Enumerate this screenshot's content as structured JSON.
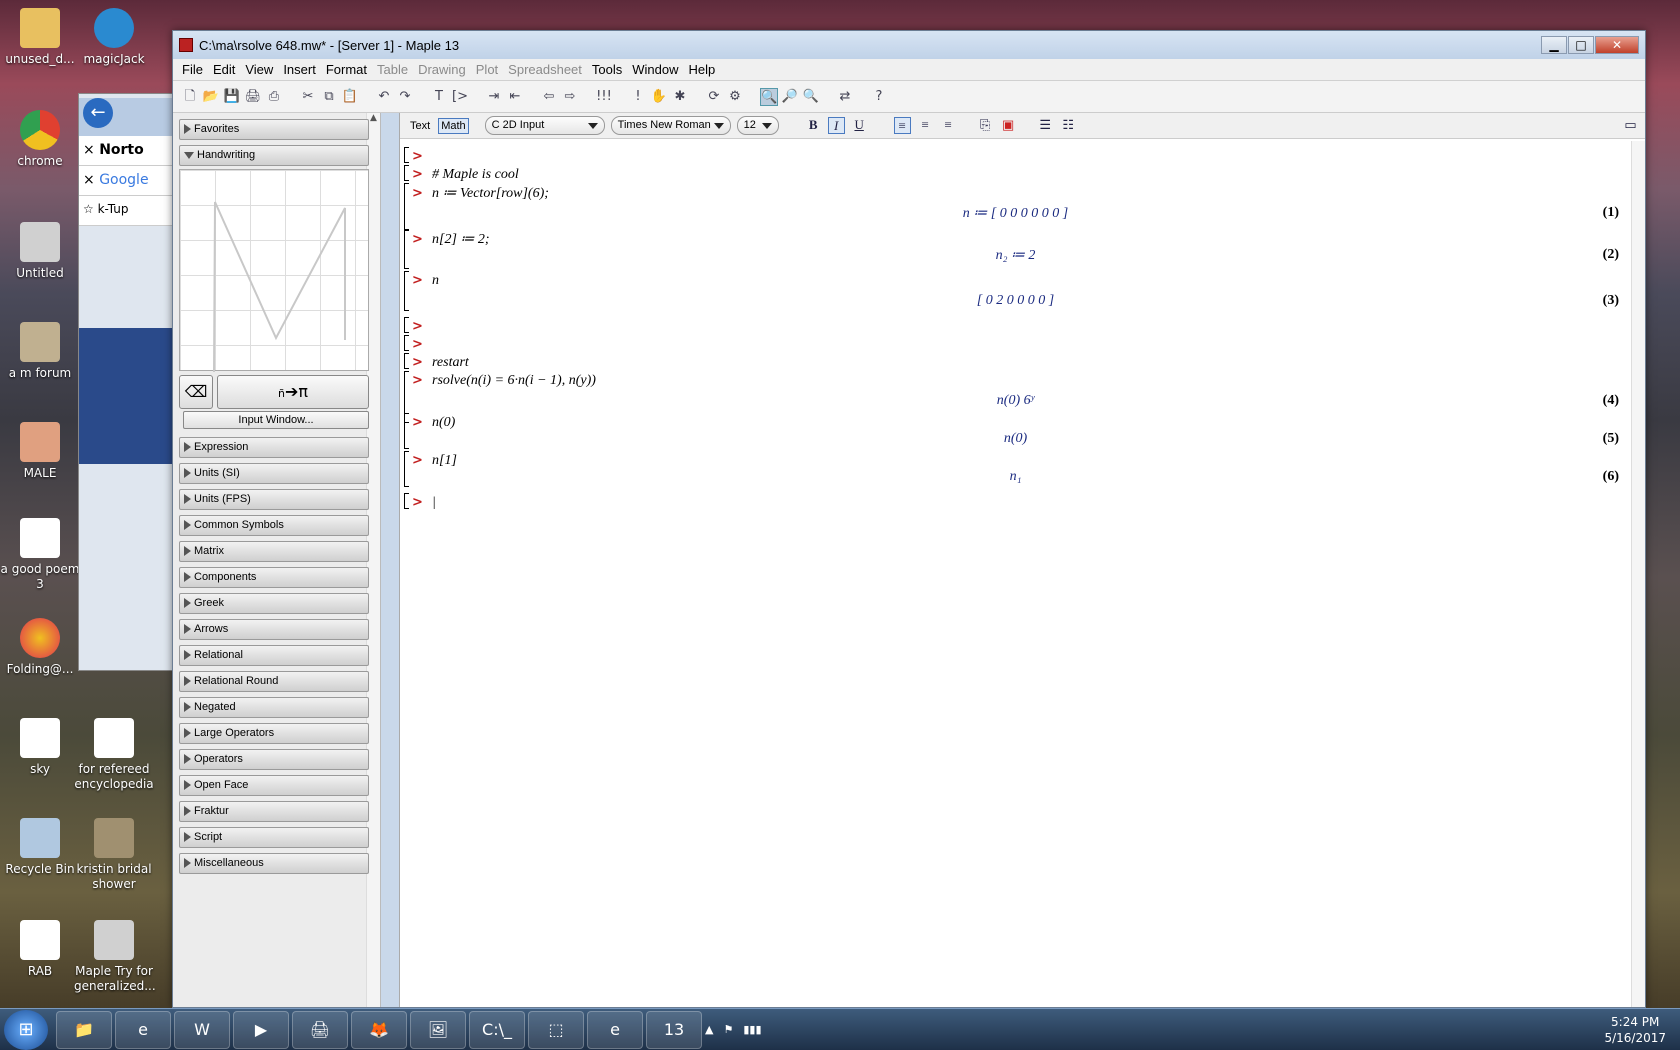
{
  "desktop": {
    "icons": [
      {
        "label": "unused_d...",
        "color": "#e8c060"
      },
      {
        "label": "magicJack",
        "color": "#2a8ad0"
      },
      {
        "label": "chrome",
        "color": "#e04030"
      },
      {
        "label": "Untitled",
        "color": "#d0d0d0"
      },
      {
        "label": "a m forum",
        "color": "#c0b090"
      },
      {
        "label": "MALE",
        "color": "#e0a080"
      },
      {
        "label": "a good poem 3",
        "color": "#ffffff"
      },
      {
        "label": "Folding@...",
        "color": "#e03050"
      },
      {
        "label": "sky",
        "color": "#ffffff"
      },
      {
        "label": "for refereed encyclopedia",
        "color": "#ffffff"
      },
      {
        "label": "Recycle Bin",
        "color": "#b0c8e0"
      },
      {
        "label": "kristin bridal shower",
        "color": "#a09070"
      },
      {
        "label": "RAB",
        "color": "#ffffff"
      },
      {
        "label": "Maple Try for generalized...",
        "color": "#d0d0d0"
      }
    ]
  },
  "bg_browser": {
    "tabs": [
      "Norto",
      "Google",
      "k-Tup"
    ]
  },
  "window": {
    "title": "C:\\ma\\rsolve 648.mw* - [Server 1] - Maple 13",
    "controls": {
      "minimize": "▁",
      "maximize": "□",
      "close": "✕"
    }
  },
  "menu": [
    {
      "label": "File",
      "enabled": true
    },
    {
      "label": "Edit",
      "enabled": true
    },
    {
      "label": "View",
      "enabled": true
    },
    {
      "label": "Insert",
      "enabled": true
    },
    {
      "label": "Format",
      "enabled": true
    },
    {
      "label": "Table",
      "enabled": false
    },
    {
      "label": "Drawing",
      "enabled": false
    },
    {
      "label": "Plot",
      "enabled": false
    },
    {
      "label": "Spreadsheet",
      "enabled": false
    },
    {
      "label": "Tools",
      "enabled": true
    },
    {
      "label": "Window",
      "enabled": true
    },
    {
      "label": "Help",
      "enabled": true
    }
  ],
  "toolbar": {
    "icons": [
      "new-icon",
      "open-icon",
      "save-icon",
      "print-icon",
      "print-preview-icon",
      "cut-icon",
      "copy-icon",
      "paste-icon",
      "undo-icon",
      "redo-icon",
      "text-icon",
      "execution-group-icon",
      "indent-icon",
      "outdent-icon",
      "back-icon",
      "forward-icon",
      "execute-all-icon",
      "execute-icon",
      "interrupt-icon",
      "debug-icon",
      "restart-icon",
      "settings-icon",
      "zoom-icon",
      "zoom-in-icon",
      "zoom-out-icon",
      "toggle-icon",
      "help-icon"
    ],
    "glyphs": [
      "🗋",
      "📂",
      "💾",
      "🖨",
      "⎙",
      "✂",
      "⧉",
      "📋",
      "↶",
      "↷",
      "T",
      "[>",
      "⇥",
      "⇤",
      "⇦",
      "⇨",
      "!!!",
      "!",
      "✋",
      "✱",
      "⟳",
      "⚙",
      "🔍",
      "🔎",
      "🔍",
      "⇄",
      "?"
    ]
  },
  "palettes": {
    "items": [
      "Favorites",
      "Handwriting",
      "Expression",
      "Units (SI)",
      "Units (FPS)",
      "Common Symbols",
      "Matrix",
      "Components",
      "Greek",
      "Arrows",
      "Relational",
      "Relational Round",
      "Negated",
      "Large Operators",
      "Operators",
      "Open Face",
      "Fraktur",
      "Script",
      "Miscellaneous"
    ],
    "expanded": "Handwriting",
    "handwriting": {
      "convert_label": "π",
      "convert_prefix": "ñ",
      "input_window_label": "Input Window..."
    }
  },
  "context_bar": {
    "mode_text": "Text",
    "mode_math": "Math",
    "input_style": "2D Input",
    "input_style_prefix": "C",
    "font": "Times New Roman",
    "size": "12",
    "bold": "B",
    "italic": "I",
    "underline": "U"
  },
  "worksheet": {
    "prompt_symbol": ">",
    "inputs": [
      {
        "text": ""
      },
      {
        "text": "# Maple is cool"
      },
      {
        "text": "n ≔ Vector[row](6);"
      },
      {
        "text": "n[2] ≔ 2;"
      },
      {
        "text": "n"
      },
      {
        "text": ""
      },
      {
        "text": ""
      },
      {
        "text": "restart"
      },
      {
        "text": "rsolve(n(i) = 6·n(i − 1), n(y))"
      },
      {
        "text": "n(0)"
      },
      {
        "text": "n[1]"
      },
      {
        "text": "|"
      }
    ],
    "outputs": [
      {
        "text": "n ≔ [ 0  0  0  0  0  0 ]",
        "label": "(1)"
      },
      {
        "text": "n₂ ≔ 2",
        "label": "(2)"
      },
      {
        "text": "[ 0  2  0  0  0  0 ]",
        "label": "(3)"
      },
      {
        "text": "n(0) 6ʸ",
        "label": "(4)"
      },
      {
        "text": "n(0)",
        "label": "(5)"
      },
      {
        "text": "n₁",
        "label": "(6)"
      }
    ]
  },
  "taskbar": {
    "start_glyph": "⊞",
    "apps": [
      "📁",
      "e",
      "W",
      "▶",
      "🖨",
      "🦊",
      "🖼",
      "C:\\_",
      "⬚",
      "e",
      "13"
    ],
    "tray_icons": [
      "▲",
      "⚑",
      "▮▮▮"
    ],
    "time": "5:24 PM",
    "date": "5/16/2017"
  }
}
